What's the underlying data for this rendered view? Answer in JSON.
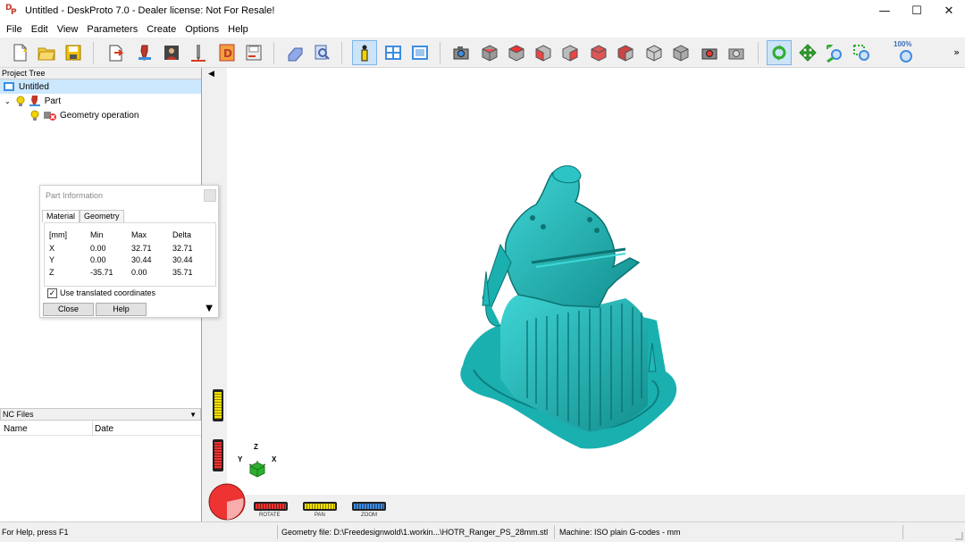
{
  "window": {
    "title": "Untitled - DeskProto 7.0 - Dealer license: Not For Resale!",
    "minimize": "—",
    "maximize": "☐",
    "close": "✕"
  },
  "menu": [
    "File",
    "Edit",
    "View",
    "Parameters",
    "Create",
    "Options",
    "Help"
  ],
  "toolbar": {
    "zoom_level": "100%",
    "overflow": "»"
  },
  "project_tree": {
    "header": "Project Tree",
    "items": [
      {
        "label": "Untitled"
      },
      {
        "label": "Part"
      },
      {
        "label": "Geometry operation"
      }
    ]
  },
  "part_info": {
    "title": "Part Information",
    "tabs": [
      "Material",
      "Geometry"
    ],
    "headers": [
      "[mm]",
      "Min",
      "Max",
      "Delta"
    ],
    "rows": [
      [
        "X",
        "0.00",
        "32.71",
        "32.71"
      ],
      [
        "Y",
        "0.00",
        "30.44",
        "30.44"
      ],
      [
        "Z",
        "-35.71",
        "0.00",
        "35.71"
      ]
    ],
    "checkbox_label": "Use translated coordinates",
    "close_label": "Close",
    "help_label": "Help"
  },
  "nc_files": {
    "header": "NC Files",
    "columns": [
      "Name",
      "Date"
    ]
  },
  "viewport": {
    "modes": [
      "ROTATE",
      "PAN",
      "ZOOM"
    ],
    "axes": {
      "x": "X",
      "y": "Y",
      "z": "Z"
    },
    "colors": {
      "model": "#1fb3b3",
      "rotate": "#d93a1a",
      "pan": "#e8d11f",
      "zoom": "#3d8de0"
    }
  },
  "status": {
    "help": "For Help, press F1",
    "geometry_file": "Geometry file: D:\\Freedesignwold\\1.workin...\\HOTR_Ranger_PS_28mm.stl",
    "machine": "Machine: ISO plain G-codes - mm"
  }
}
